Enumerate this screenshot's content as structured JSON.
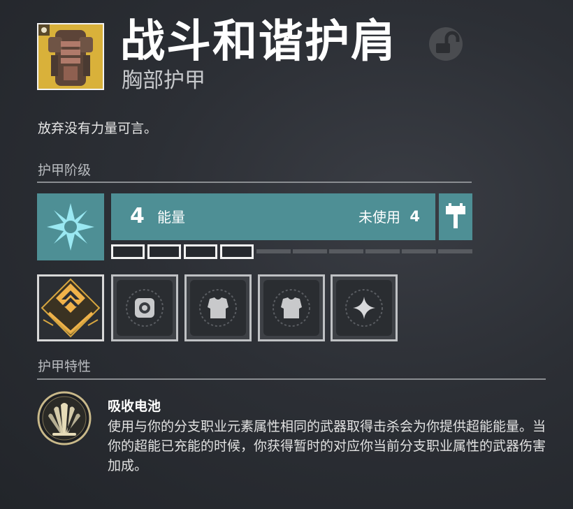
{
  "item": {
    "name": "战斗和谐护肩",
    "type": "胸部护甲",
    "flavor": "放弃没有力量可言。",
    "icon": "titan-chest-armor-icon",
    "lock_icon": "unlocked-icon"
  },
  "armor_tier": {
    "section_title": "护甲阶级",
    "element_icon": "void-star-icon",
    "energy_value": "4",
    "energy_label": "能量",
    "unused_label": "未使用",
    "unused_value": "4",
    "class_icon": "titan-hammer-icon",
    "energy_level": 4,
    "energy_capacity": 10,
    "energy_color": "#4e8f95"
  },
  "mods": [
    {
      "icon": "artifice-armor-icon",
      "state": "intrinsic"
    },
    {
      "icon": "general-mod-socket-icon",
      "state": "empty"
    },
    {
      "icon": "chest-mod-socket-icon",
      "state": "empty"
    },
    {
      "icon": "chest-mod-socket-icon",
      "state": "empty"
    },
    {
      "icon": "sparkle-mod-socket-icon",
      "state": "empty"
    }
  ],
  "perks": {
    "section_title": "护甲特性",
    "items": [
      {
        "name": "吸收电池",
        "description": "使用与你的分支职业元素属性相同的武器取得击杀会为你提供超能能量。当你的超能已充能的时候，你获得暂时的对应你当前分支职业属性的武器伤害加成。",
        "icon": "perk-fan-icon"
      }
    ]
  }
}
